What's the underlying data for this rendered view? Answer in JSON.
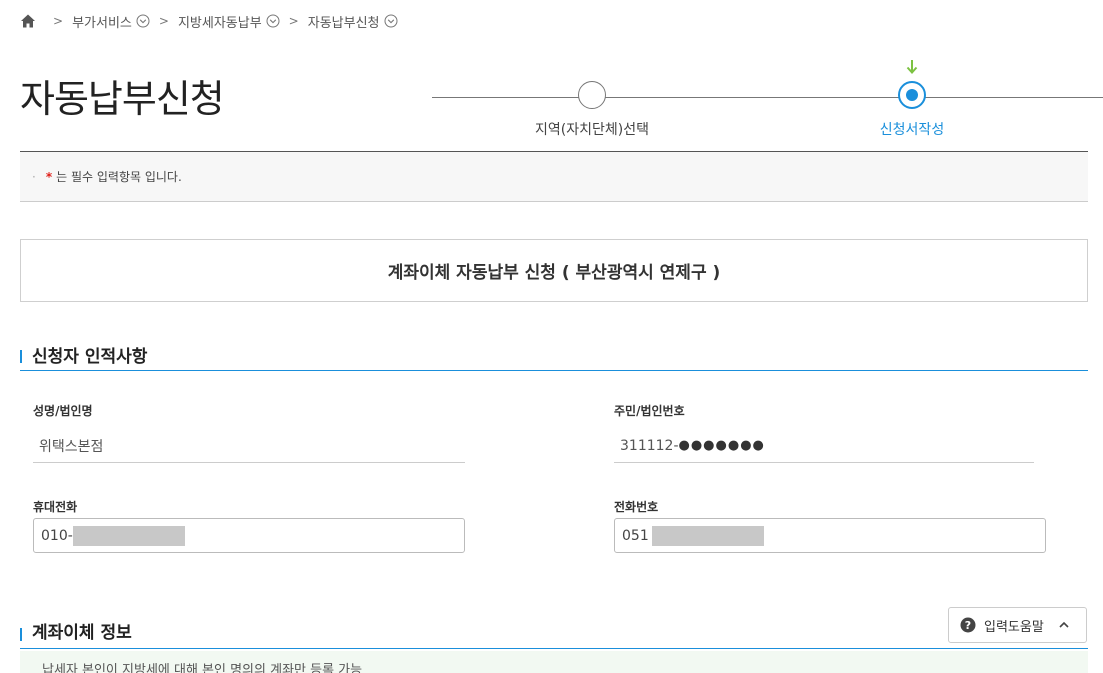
{
  "breadcrumb": {
    "items": [
      "부가서비스",
      "지방세자동납부",
      "자동납부신청"
    ],
    "separator": ">"
  },
  "page": {
    "title": "자동납부신청"
  },
  "steps": [
    {
      "label": "지역(자치단체)선택",
      "state": "done"
    },
    {
      "label": "신청서작성",
      "state": "current"
    }
  ],
  "notice": {
    "bullet": "·",
    "required_mark": "*",
    "text": "는 필수 입력항목 입니다."
  },
  "banner": {
    "text": "계좌이체 자동납부 신청 ( 부산광역시  연제구 )"
  },
  "applicant": {
    "section_title": "신청자 인적사항",
    "name_label": "성명/법인명",
    "name_value": "위택스본점",
    "id_label": "주민/법인번호",
    "id_prefix": "311112-",
    "id_masked": "●●●●●●●",
    "mobile_label": "휴대전화",
    "mobile_value": "010-",
    "phone_label": "전화번호",
    "phone_value": "051"
  },
  "transfer": {
    "section_title": "계좌이체 정보",
    "help_label": "입력도움말",
    "note_partial": "납세자 본인이 지방세에 대해 본인 명의의 계좌만 등록 가능"
  },
  "colors": {
    "accent": "#1a8fdb",
    "required": "#e0201a",
    "note_bg": "#f2f9f2"
  },
  "icons": [
    "home-icon",
    "chevron-down-icon",
    "arrow-down-icon",
    "question-icon",
    "chevron-up-icon"
  ]
}
